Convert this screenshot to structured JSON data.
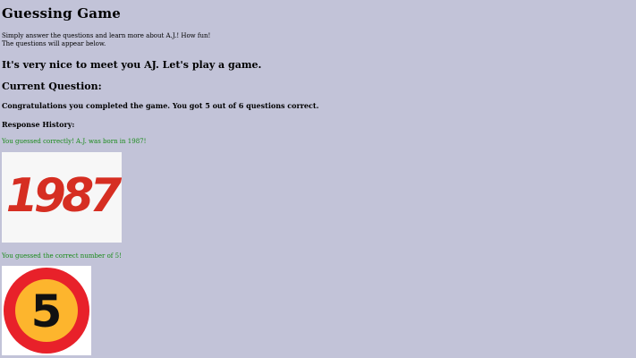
{
  "header": {
    "title": "Guessing Game"
  },
  "intro": {
    "line1": "Simply answer the questions and learn more about A.J.! How fun!",
    "line2": "The questions will appear below."
  },
  "greeting": "It's very nice to meet you AJ. Let's play a game.",
  "current_question": {
    "heading": "Current Question:",
    "text": "Congratulations you completed the game. You got 5 out of 6 questions correct."
  },
  "history": {
    "heading": "Response History:",
    "responses": [
      {
        "message": "You guessed correctly! A.J. was born in 1987!",
        "image_text": "1987",
        "image_color": "#d62e22"
      },
      {
        "message": "You guessed the correct number of 5!",
        "image_text": "5",
        "image_ring_color": "#e8212a",
        "image_fill_color": "#fdb52d"
      }
    ]
  },
  "colors": {
    "background": "#c2c3d8",
    "response_text": "#188a18"
  }
}
